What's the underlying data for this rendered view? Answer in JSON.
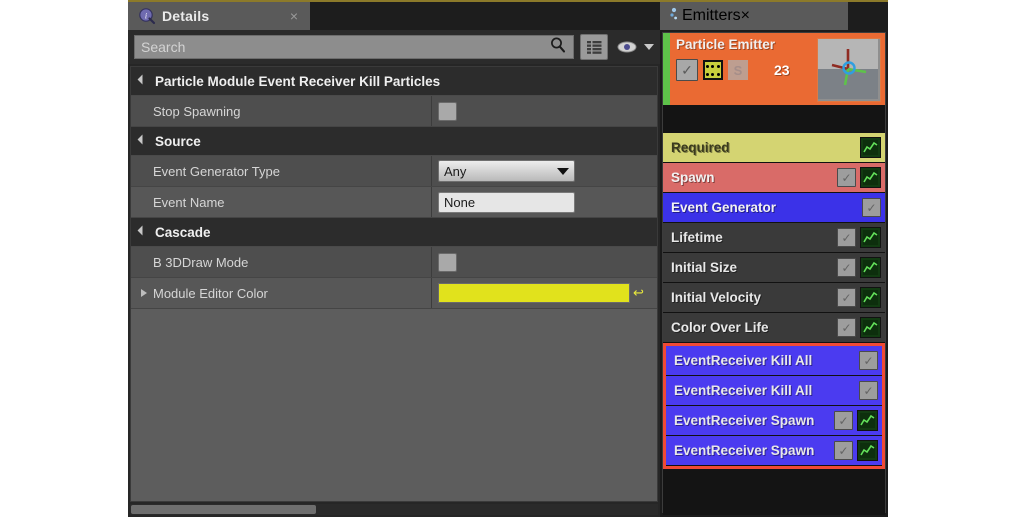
{
  "app": {
    "title": "Unreal Cascade Particle Editor"
  },
  "details": {
    "tab": {
      "label": "Details",
      "icon": "info-icon",
      "close": "×"
    },
    "search": {
      "placeholder": "Search",
      "search_icon": "magnifier-icon",
      "grid_icon": "grid-view-icon",
      "eye_icon": "eye-icon",
      "chevron": "chevron-down-icon"
    },
    "categories": [
      {
        "title": "Particle Module Event Receiver Kill Particles",
        "rows": [
          {
            "name": "Stop Spawning",
            "type": "checkbox",
            "value": ""
          }
        ]
      },
      {
        "title": "Source",
        "rows": [
          {
            "name": "Event Generator Type",
            "type": "combo",
            "value": "Any"
          },
          {
            "name": "Event Name",
            "type": "text",
            "value": "None"
          }
        ]
      },
      {
        "title": "Cascade",
        "rows": [
          {
            "name": "B 3DDraw Mode",
            "type": "checkbox",
            "value": ""
          },
          {
            "name": "Module Editor Color",
            "type": "color",
            "value": "#e1e21c",
            "expandable": true,
            "reset": "↩"
          }
        ]
      }
    ]
  },
  "emitters": {
    "tab": {
      "label": "Emitters",
      "icon": "emitter-icon",
      "close": "×"
    },
    "emitter": {
      "name": "Particle Emitter",
      "count": "23",
      "solo_label": "S",
      "enabled_check": "✓",
      "header_color": "#ea6a33",
      "accent_color": "#5ec24a"
    },
    "modules": [
      {
        "label": "Required",
        "bg": "#d4d472",
        "text": "#3a3a1e",
        "checkbox": false,
        "graph": true,
        "selected": false
      },
      {
        "label": "Spawn",
        "bg": "#d96b68",
        "text": "#f2f2f2",
        "checkbox": true,
        "graph": true,
        "selected": false
      },
      {
        "label": "Event Generator",
        "bg": "#3b32e8",
        "text": "#f2f2f2",
        "checkbox": true,
        "graph": false,
        "selected": false
      },
      {
        "label": "Lifetime",
        "bg": "#3a3a3a",
        "text": "#e8e8e8",
        "checkbox": true,
        "graph": true,
        "selected": false
      },
      {
        "label": "Initial Size",
        "bg": "#3a3a3a",
        "text": "#e8e8e8",
        "checkbox": true,
        "graph": true,
        "selected": false
      },
      {
        "label": "Initial Velocity",
        "bg": "#3a3a3a",
        "text": "#e8e8e8",
        "checkbox": true,
        "graph": true,
        "selected": false
      },
      {
        "label": "Color Over Life",
        "bg": "#3a3a3a",
        "text": "#e8e8e8",
        "checkbox": true,
        "graph": true,
        "selected": false
      },
      {
        "label": "EventReceiver Kill All",
        "bg": "#4b3bf0",
        "text": "#e8e8e8",
        "checkbox": true,
        "graph": false,
        "selected": true
      },
      {
        "label": "EventReceiver Kill All",
        "bg": "#4b3bf0",
        "text": "#e8e8e8",
        "checkbox": true,
        "graph": false,
        "selected": true
      },
      {
        "label": "EventReceiver Spawn",
        "bg": "#4b3bf0",
        "text": "#e8e8e8",
        "checkbox": true,
        "graph": true,
        "selected": true
      },
      {
        "label": "EventReceiver Spawn",
        "bg": "#4b3bf0",
        "text": "#e8e8e8",
        "checkbox": true,
        "graph": true,
        "selected": true
      }
    ],
    "selection_color": "#f04a35"
  }
}
